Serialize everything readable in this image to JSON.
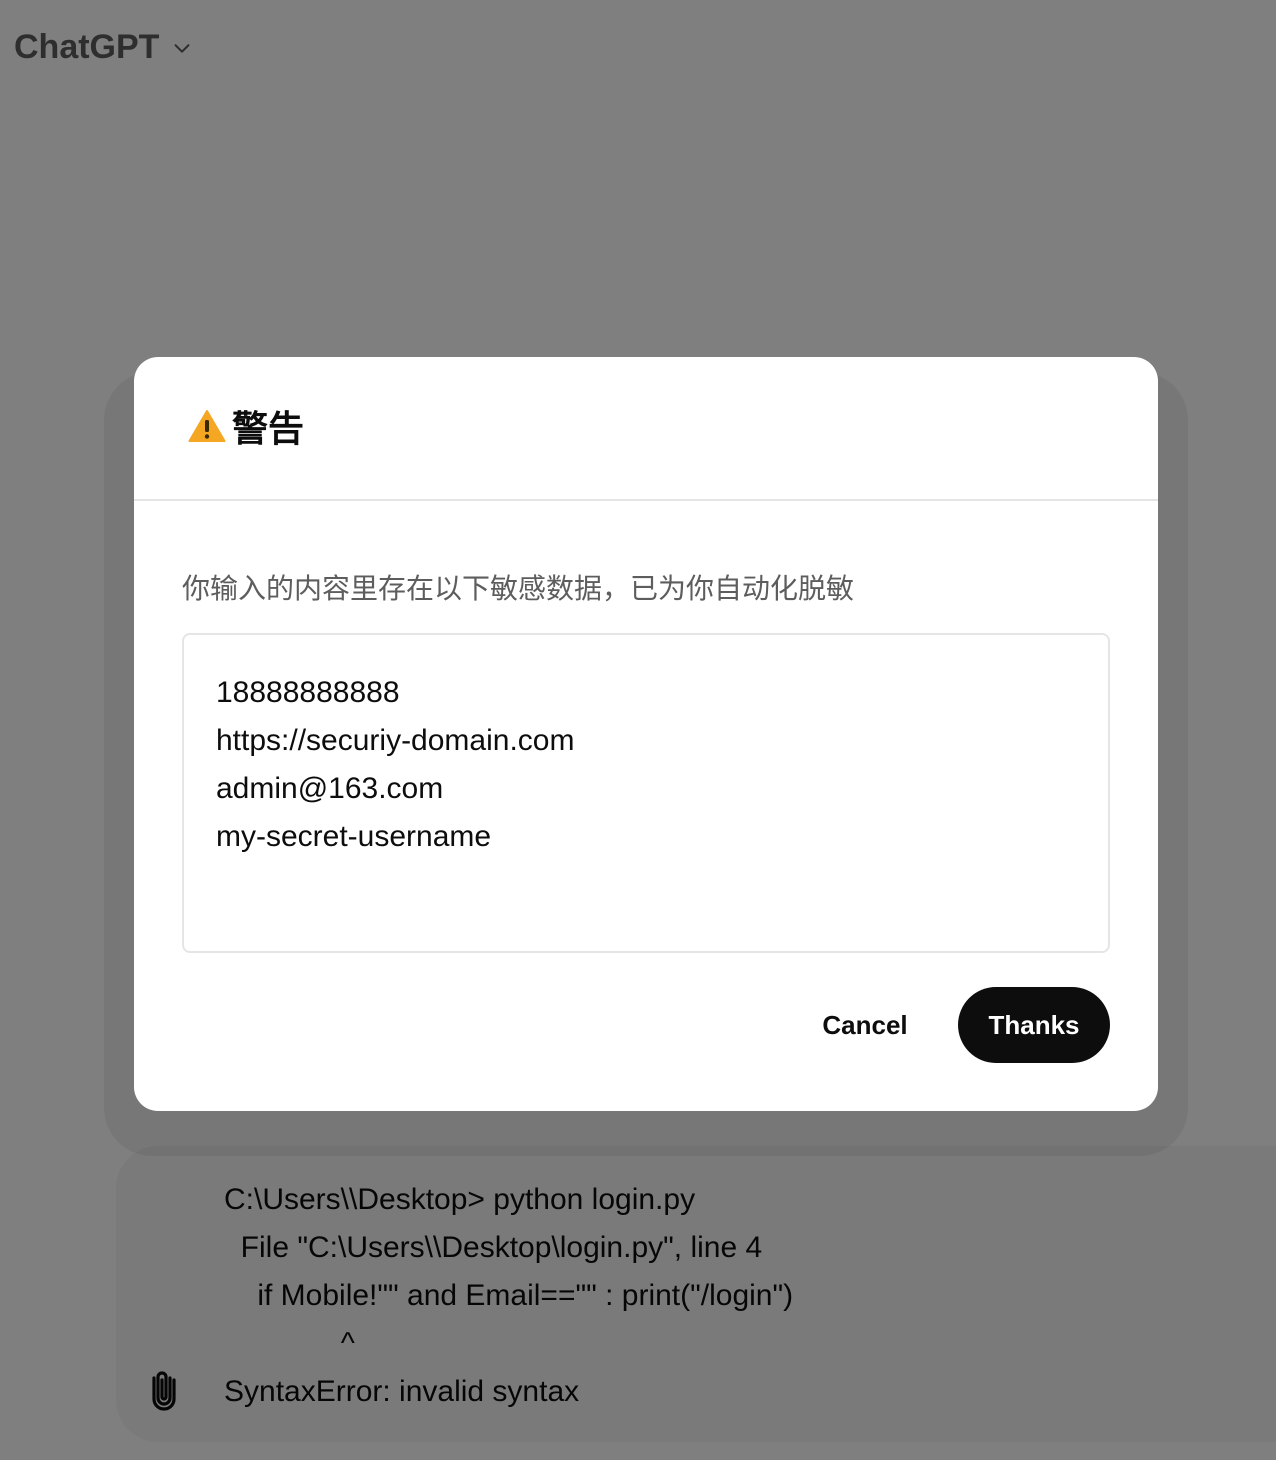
{
  "header": {
    "app_name": "ChatGPT",
    "model_menu_icon": "chevron-down-icon"
  },
  "composer": {
    "text": "C:\\Users\\\\Desktop> python login.py\n  File \"C:\\Users\\\\Desktop\\login.py\", line 4\n    if Mobile!\"\" and Email==\"\" : print(\"/login\")\n              ^\nSyntaxError: invalid syntax",
    "attach_icon": "paperclip-icon"
  },
  "dialog": {
    "icon": "warning-icon",
    "title": "警告",
    "message": "你输入的内容里存在以下敏感数据，已为你自动化脱敏",
    "sensitive_items": [
      "18888888888",
      "https://securiy-domain.com",
      "admin@163.com",
      "my-secret-username"
    ],
    "cancel_label": "Cancel",
    "confirm_label": "Thanks"
  },
  "colors": {
    "overlay": "rgba(0,0,0,0.5)",
    "primary_button": "#0d0d0d",
    "warning_icon": "#f5a623"
  }
}
